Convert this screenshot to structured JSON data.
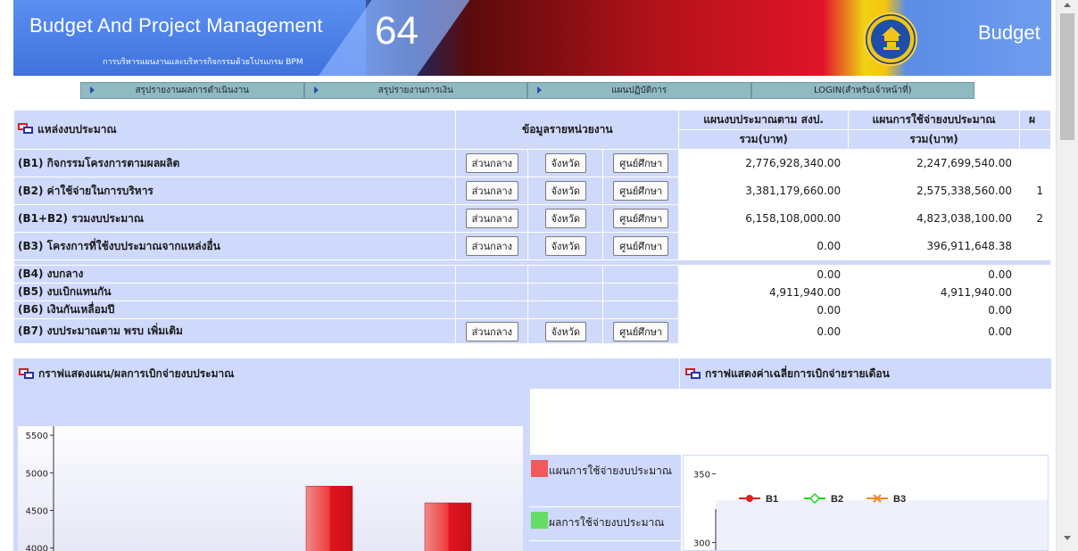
{
  "banner": {
    "title": "Budget And Project Management",
    "subtitle": "การบริหารแผนงานและบริหารกิจกรรมด้วยโปรแกรม BPM",
    "year": "64",
    "right_title": "Budget",
    "logo_icon": "emblem-icon"
  },
  "nav": {
    "items": [
      {
        "label": "สรุปรายงานผลการดำเนินงาน"
      },
      {
        "label": "สรุปรายงานการเงิน"
      },
      {
        "label": "แผนปฏิบัติการ"
      },
      {
        "label": "LOGIN(สำหรับเจ้าหน้าที่)"
      }
    ]
  },
  "table": {
    "source_header": "แหล่งงบประมาณ",
    "unit_header": "ข้อมูลรายหน่วยงาน",
    "plan_header": "แผนงบประมาณตาม สงป.",
    "spend_header": "แผนการใช้จ่ายงบประมาณ",
    "extra_header": "ผ",
    "total_label": "รวม(บาท)",
    "button_labels": {
      "central": "ส่วนกลาง",
      "province": "จังหวัด",
      "center": "ศูนย์ศึกษา"
    },
    "rows": [
      {
        "label": "(B1) กิจกรรมโครงการตามผลผลิต",
        "plan": "2,776,928,340.00",
        "spend": "2,247,699,540.00",
        "extra": "",
        "buttons": true
      },
      {
        "label": "(B2) ค่าใช้จ่ายในการบริหาร",
        "plan": "3,381,179,660.00",
        "spend": "2,575,338,560.00",
        "extra": "1",
        "buttons": true
      },
      {
        "label": "(B1+B2) รวมงบประมาณ",
        "plan": "6,158,108,000.00",
        "spend": "4,823,038,100.00",
        "extra": "2",
        "buttons": true
      },
      {
        "label": "(B3) โครงการที่ใช้งบประมาณจากแหล่งอื่น",
        "plan": "0.00",
        "spend": "396,911,648.38",
        "extra": "",
        "buttons": true
      },
      {
        "label": "(B4) งบกลาง",
        "plan": "0.00",
        "spend": "0.00",
        "extra": "",
        "buttons": false
      },
      {
        "label": "(B5) งบเบิกแทนกัน",
        "plan": "4,911,940.00",
        "spend": "4,911,940.00",
        "extra": "",
        "buttons": false
      },
      {
        "label": "(B6) เงินกันเหลื่อมปี",
        "plan": "0.00",
        "spend": "0.00",
        "extra": "",
        "buttons": false
      },
      {
        "label": "(B7) งบประมาณตาม พรบ เพิ่มเติม",
        "plan": "0.00",
        "spend": "0.00",
        "extra": "",
        "buttons": true
      }
    ]
  },
  "sections": {
    "left_title": "กราฟแสดงแผน/ผลการเบิกจ่ายงบประมาณ",
    "right_title": "กราฟแสดงค่าเฉลี่ยการเบิกจ่ายรายเดือน"
  },
  "legend": {
    "items": [
      {
        "label": "แผนการใช้จ่ายงบประมาณ",
        "color": "#f05a5a"
      },
      {
        "label": "ผลการใช้จ่ายงบประมาณ",
        "color": "#66dd66"
      }
    ]
  },
  "chart_data": [
    {
      "type": "bar",
      "y_ticks": [
        4000,
        4500,
        5000,
        5500
      ],
      "ylim": [
        3960,
        5620
      ],
      "series": [
        {
          "values": [
            4823,
            4600
          ],
          "color": "#e8202a"
        }
      ]
    },
    {
      "type": "line",
      "y_ticks": [
        300,
        350
      ],
      "ylim": [
        290,
        360
      ],
      "series": [
        {
          "name": "B1",
          "color": "#e11d1d",
          "marker": "circle"
        },
        {
          "name": "B2",
          "color": "#23d323",
          "marker": "diamond"
        },
        {
          "name": "B3",
          "color": "#f08a1e",
          "marker": "x"
        }
      ]
    }
  ]
}
